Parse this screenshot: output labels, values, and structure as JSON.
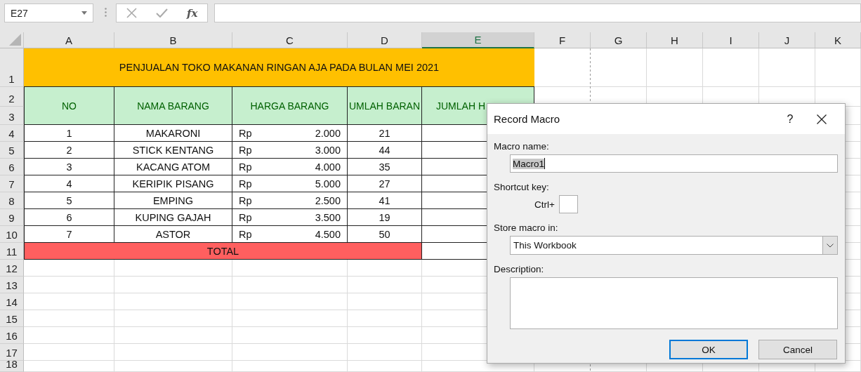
{
  "name_box": {
    "value": "E27"
  },
  "formula_bar": {
    "function_label": "fx"
  },
  "columns": [
    {
      "label": "A",
      "selected": false
    },
    {
      "label": "B",
      "selected": false
    },
    {
      "label": "C",
      "selected": false
    },
    {
      "label": "D",
      "selected": false
    },
    {
      "label": "E",
      "selected": true
    },
    {
      "label": "F",
      "selected": false
    },
    {
      "label": "G",
      "selected": false
    },
    {
      "label": "H",
      "selected": false
    },
    {
      "label": "I",
      "selected": false
    },
    {
      "label": "J",
      "selected": false
    },
    {
      "label": "K",
      "selected": false
    }
  ],
  "row_headers": [
    "1",
    "2",
    "3",
    "4",
    "5",
    "6",
    "7",
    "8",
    "9",
    "10",
    "11",
    "12",
    "13",
    "14",
    "15",
    "16",
    "17",
    "18"
  ],
  "sheet": {
    "title": "PENJUALAN TOKO MAKANAN RINGAN AJA PADA BULAN MEI 2021",
    "headers": [
      "NO",
      "NAMA BARANG",
      "HARGA BARANG",
      "UMLAH BARAN",
      "JUMLAH H"
    ],
    "items": [
      {
        "no": "1",
        "name": "MAKARONI",
        "currency": "Rp",
        "price": "2.000",
        "qty": "21"
      },
      {
        "no": "2",
        "name": "STICK KENTANG",
        "currency": "Rp",
        "price": "3.000",
        "qty": "44"
      },
      {
        "no": "3",
        "name": "KACANG ATOM",
        "currency": "Rp",
        "price": "4.000",
        "qty": "35"
      },
      {
        "no": "4",
        "name": "KERIPIK PISANG",
        "currency": "Rp",
        "price": "5.000",
        "qty": "27"
      },
      {
        "no": "5",
        "name": "EMPING",
        "currency": "Rp",
        "price": "2.500",
        "qty": "41"
      },
      {
        "no": "6",
        "name": "KUPING GAJAH",
        "currency": "Rp",
        "price": "3.500",
        "qty": "19"
      },
      {
        "no": "7",
        "name": "ASTOR",
        "currency": "Rp",
        "price": "4.500",
        "qty": "50"
      }
    ],
    "total_label": "TOTAL"
  },
  "dialog": {
    "title": "Record Macro",
    "help": "?",
    "macro_name_label": "Macro name:",
    "macro_name": {
      "value": "Macro1",
      "selected": true
    },
    "shortcut_label": "Shortcut key:",
    "shortcut_prefix": "Ctrl+",
    "store_label": "Store macro in:",
    "store_value": "This Workbook",
    "description_label": "Description:",
    "buttons": [
      {
        "label": "OK",
        "default": true
      },
      {
        "label": "Cancel",
        "default": false
      }
    ]
  }
}
